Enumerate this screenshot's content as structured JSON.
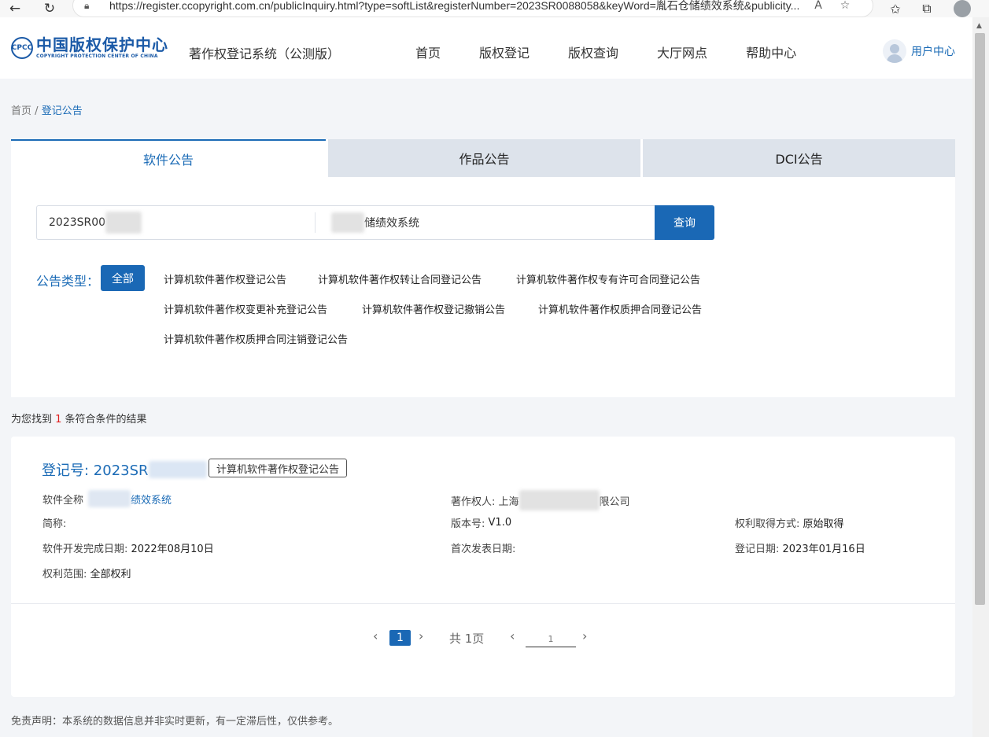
{
  "browser": {
    "url": "https://register.ccopyright.com.cn/publicInquiry.html?type=softList&registerNumber=2023SR0088058&keyWord=胤石仓储绩效系统&publicity...",
    "icons": [
      "back-arrow-icon",
      "refresh-icon",
      "lock-icon",
      "read-aloud-icon",
      "favorite-icon",
      "favorites-bar-icon",
      "collections-icon",
      "profile-icon"
    ]
  },
  "header": {
    "logo_cn": "中国版权保护中心",
    "logo_en": "COPYRIGHT PROTECTION CENTER OF CHINA",
    "logo_mark": "CPCC",
    "system_title": "著作权登记系统（公测版）",
    "nav": [
      "首页",
      "版权登记",
      "版权查询",
      "大厅网点",
      "帮助中心"
    ],
    "user_center": "用户中心"
  },
  "breadcrumb": {
    "home": "首页",
    "sep": "/",
    "current": "登记公告"
  },
  "tabs": [
    {
      "label": "软件公告",
      "active": true
    },
    {
      "label": "作品公告",
      "active": false
    },
    {
      "label": "DCI公告",
      "active": false
    }
  ],
  "search": {
    "register_number": "2023SR00",
    "keyword_visible": "储绩效系统",
    "button": "查询"
  },
  "announcement_types": {
    "label": "公告类型：",
    "all": "全部",
    "options": [
      "计算机软件著作权登记公告",
      "计算机软件著作权转让合同登记公告",
      "计算机软件著作权专有许可合同登记公告",
      "计算机软件著作权变更补充登记公告",
      "计算机软件著作权登记撤销公告",
      "计算机软件著作权质押合同登记公告",
      "计算机软件著作权质押合同注销登记公告"
    ]
  },
  "result_count": {
    "prefix": "为您找到 ",
    "count": "1",
    "suffix": " 条符合条件的结果"
  },
  "result": {
    "reg_label": "登记号: 2023SR",
    "tag": "计算机软件著作权登记公告",
    "software_name_label": "软件全称",
    "software_name_visible": "绩效系统",
    "owner_label": "著作权人: 上海",
    "owner_suffix": "限公司",
    "short_name_label": "简称:",
    "version_label": "版本号:",
    "version": "V1.0",
    "acquire_label": "权利取得方式:",
    "acquire": "原始取得",
    "dev_date_label": "软件开发完成日期:",
    "dev_date": "2022年08月10日",
    "publish_date_label": "首次发表日期:",
    "reg_date_label": "登记日期:",
    "reg_date": "2023年01月16日",
    "scope_label": "权利范围:",
    "scope": "全部权利"
  },
  "pager": {
    "current": "1",
    "total": "共 1页",
    "input_value": "1"
  },
  "disclaimer": "免责声明：本系统的数据信息并非实时更新，有一定滞后性，仅供参考。",
  "colors": {
    "primary": "#1a68b5",
    "link": "#1b6bb6",
    "highlight": "#e02020",
    "tab_inactive": "#dde3eb"
  }
}
